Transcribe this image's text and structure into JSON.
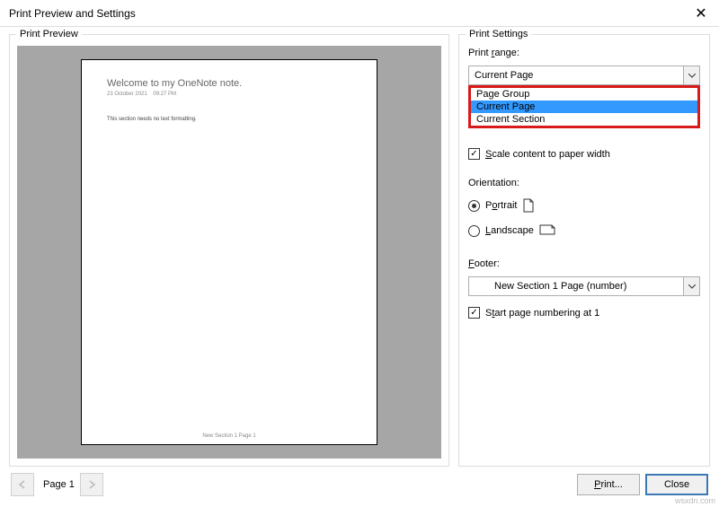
{
  "titlebar": {
    "title": "Print Preview and Settings"
  },
  "preview": {
    "group_label": "Print Preview",
    "page": {
      "title": "Welcome to my OneNote note.",
      "date": "23 October 2021",
      "time": "09:27 PM",
      "body": "This section needs no text formatting.",
      "footer": "New Section 1  Page 1"
    }
  },
  "settings": {
    "group_label": "Print Settings",
    "range_label": "Print range:",
    "range_value": "Current Page",
    "range_options": [
      "Page Group",
      "Current Page",
      "Current Section"
    ],
    "scale_label": "Scale content to paper width",
    "scale_checked": true,
    "orientation_label": "Orientation:",
    "orientation": {
      "portrait": "Portrait",
      "landscape": "Landscape",
      "selected": "portrait"
    },
    "footer_label": "Footer:",
    "footer_value": "New Section 1 Page (number)",
    "start_num_label": "Start page numbering at 1",
    "start_num_checked": true
  },
  "bottom": {
    "page_indicator": "Page 1",
    "print": "Print...",
    "close": "Close"
  },
  "watermark": "wsxdn.com"
}
